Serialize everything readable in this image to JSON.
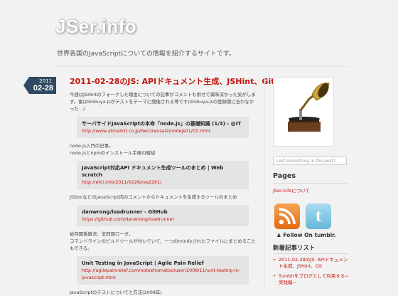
{
  "header": {
    "site_title": "JSer.info",
    "tagline": "世界各国のJavaScriptについての情報を紹介するサイトです。"
  },
  "post": {
    "date_year": "2011",
    "date_md": "02-28",
    "title": "2011-02-28のJS: APIドキュメント生成、JSHint、Git",
    "intro": "今週はJSHintのフォークした理由についての記事がコメントも併せて興味深かった気がします。後はShibuya.jsがテストをテーマに開催される等です(Shibuya.jsの登録開に合わなかった...)",
    "links": [
      {
        "title": "サーバサイドJavaScriptの本命「node.js」の基礎知識 (1/3) - @IT",
        "url": "http://www.atmarkit.co.jp/fwcr/rensai2/nodejs01/01.html"
      },
      {
        "title": "JavaScript対応API ドキュメント生成ツールのまとめ | Web scratch",
        "url": "http://efcl.info/2011/0226/res2291/"
      },
      {
        "title": "danwrong/loadrunner - GitHub",
        "url": "https://github.com/danwrong/loadrunner"
      },
      {
        "title": "Unit Testing in JavaScript | Agile Pain Relief",
        "url": "http://agilepainrelief.com/notesfromatooluser/2008/11/unit-testing-in-javascript.html"
      }
    ],
    "text_1a": "node.js入門の記事。",
    "text_1b": "node.jsとnpmのインストール手順の解説",
    "text_2": "JSDocなどのJavaScript内のコメントからドキュメントを生成するツールのまとめ",
    "text_3a": "依存関係解決、非同期ローダ。",
    "text_3b": "コマンドラインのビルドツールが付いていて、一つのminifyされたファイルにまとめることもできる。",
    "text_4": "JavaScriptのテストについてと方法(2008年)"
  },
  "sidebar": {
    "search_placeholder": "Lost something in the post?",
    "pages_heading": "Pages",
    "pages_link": "JSer.infoについて",
    "follow_label": "Follow On tumblr.",
    "tumblr_glyph": "t",
    "recent_heading": "新着記事リスト",
    "recent": [
      "2011-02-28のJS: APIドキュメント生成、JSHint、Git",
      "Tumblrをブログとして利用する~実践編~"
    ]
  },
  "colors": {
    "accent": "#c4140e",
    "date_badge": "#2f4a62",
    "background": "#f2f2f2"
  },
  "icons": [
    "gramophone-icon",
    "rss-icon",
    "tumblr-icon",
    "search-icon"
  ]
}
